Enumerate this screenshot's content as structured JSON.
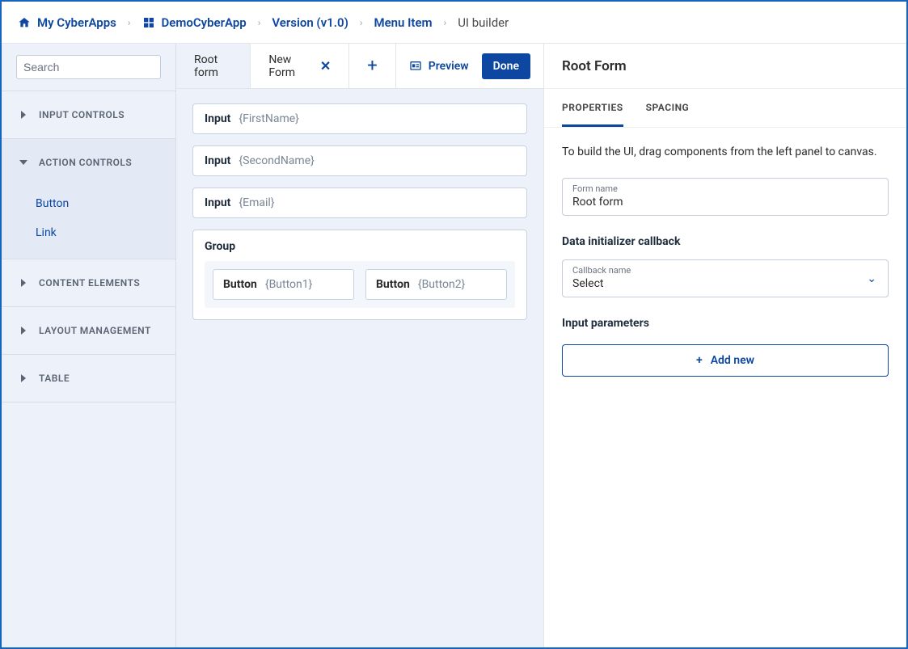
{
  "breadcrumb": [
    {
      "label": "My CyberApps",
      "icon": "home"
    },
    {
      "label": "DemoCyberApp",
      "icon": "apps"
    },
    {
      "label": "Version (v1.0)"
    },
    {
      "label": "Menu Item"
    },
    {
      "label": "UI builder",
      "current": true
    }
  ],
  "sidebar": {
    "search_placeholder": "Search",
    "categories": [
      {
        "label": "INPUT CONTROLS",
        "open": false
      },
      {
        "label": "ACTION CONTROLS",
        "open": true,
        "items": [
          "Button",
          "Link"
        ]
      },
      {
        "label": "CONTENT ELEMENTS",
        "open": false
      },
      {
        "label": "LAYOUT MANAGEMENT",
        "open": false
      },
      {
        "label": "TABLE",
        "open": false
      }
    ]
  },
  "tabs": [
    {
      "label": "Root form",
      "active": true,
      "closable": false
    },
    {
      "label": "New Form",
      "active": false,
      "closable": true
    }
  ],
  "top_actions": {
    "preview": "Preview",
    "done": "Done"
  },
  "canvas": {
    "inputs": [
      {
        "kind": "Input",
        "name": "{FirstName}"
      },
      {
        "kind": "Input",
        "name": "{SecondName}"
      },
      {
        "kind": "Input",
        "name": "{Email}"
      }
    ],
    "group": {
      "title": "Group",
      "buttons": [
        {
          "kind": "Button",
          "name": "{Button1}"
        },
        {
          "kind": "Button",
          "name": "{Button2}"
        }
      ]
    }
  },
  "right": {
    "title": "Root Form",
    "tabs": [
      "PROPERTIES",
      "SPACING"
    ],
    "active_tab": 0,
    "helper": "To build the UI, drag components from the left panel to canvas.",
    "form_name_label": "Form name",
    "form_name_value": "Root form",
    "callback_section": "Data initializer callback",
    "callback_label": "Callback name",
    "callback_value": "Select",
    "input_params_label": "Input parameters",
    "add_new": "Add new"
  }
}
